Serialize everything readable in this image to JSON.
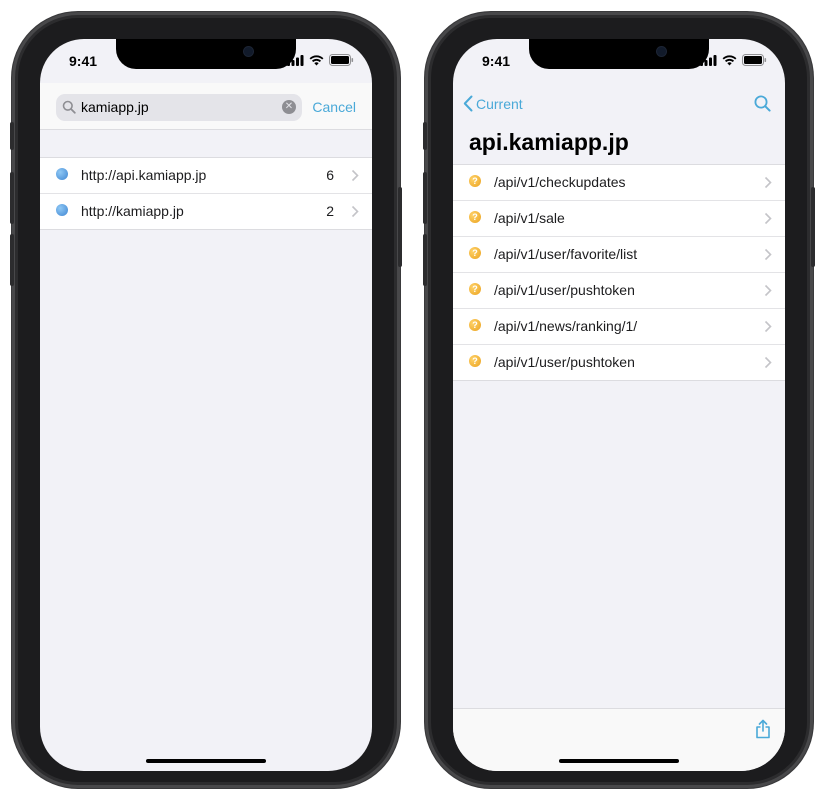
{
  "left_screen": {
    "status_time": "9:41",
    "search": {
      "query": "kamiapp.jp",
      "cancel_label": "Cancel",
      "icon": "search-icon",
      "clear_icon": "clear-icon"
    },
    "results": [
      {
        "label": "http://api.kamiapp.jp",
        "count": "6",
        "icon": "globe-icon"
      },
      {
        "label": "http://kamiapp.jp",
        "count": "2",
        "icon": "globe-icon"
      }
    ]
  },
  "right_screen": {
    "status_time": "9:41",
    "back_label": "Current",
    "title": "api.kamiapp.jp",
    "endpoints": [
      {
        "label": "/api/v1/checkupdates",
        "icon": "question-icon"
      },
      {
        "label": "/api/v1/sale",
        "icon": "question-icon"
      },
      {
        "label": "/api/v1/user/favorite/list",
        "icon": "question-icon"
      },
      {
        "label": "/api/v1/user/pushtoken",
        "icon": "question-icon"
      },
      {
        "label": "/api/v1/news/ranking/1/",
        "icon": "question-icon"
      },
      {
        "label": "/api/v1/user/pushtoken",
        "icon": "question-icon"
      }
    ],
    "toolbar_icon": "share-icon"
  },
  "colors": {
    "accent": "#4aa9d8",
    "background": "#f2f2f7",
    "warning": "#eaa11e",
    "globe": "#3f86d2"
  }
}
